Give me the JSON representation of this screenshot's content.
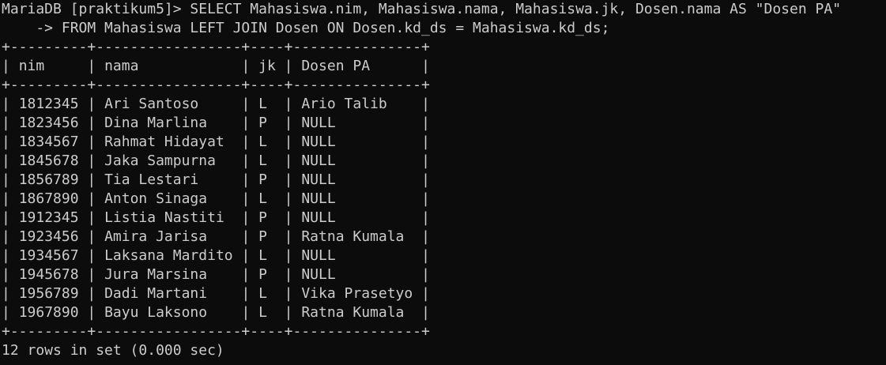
{
  "terminal": {
    "prompt": "MariaDB [praktikum5]> ",
    "command_line1": "SELECT Mahasiswa.nim, Mahasiswa.nama, Mahasiswa.jk, Dosen.nama AS \"Dosen PA\"",
    "continuation_prompt": "    -> ",
    "command_line2": "FROM Mahasiswa LEFT JOIN Dosen ON Dosen.kd_ds = Mahasiswa.kd_ds;",
    "result_footer": "12 rows in set (0.000 sec)",
    "colors": {
      "background": "#0c0c0c",
      "foreground": "#cccccc"
    }
  },
  "result_table": {
    "columns": [
      "nim",
      "nama",
      "jk",
      "Dosen PA"
    ],
    "rows": [
      [
        "1812345",
        "Ari Santoso",
        "L",
        "Ario Talib"
      ],
      [
        "1823456",
        "Dina Marlina",
        "P",
        "NULL"
      ],
      [
        "1834567",
        "Rahmat Hidayat",
        "L",
        "NULL"
      ],
      [
        "1845678",
        "Jaka Sampurna",
        "L",
        "NULL"
      ],
      [
        "1856789",
        "Tia Lestari",
        "P",
        "NULL"
      ],
      [
        "1867890",
        "Anton Sinaga",
        "L",
        "NULL"
      ],
      [
        "1912345",
        "Listia Nastiti",
        "P",
        "NULL"
      ],
      [
        "1923456",
        "Amira Jarisa",
        "P",
        "Ratna Kumala"
      ],
      [
        "1934567",
        "Laksana Mardito",
        "L",
        "NULL"
      ],
      [
        "1945678",
        "Jura Marsina",
        "P",
        "NULL"
      ],
      [
        "1956789",
        "Dadi Martani",
        "L",
        "Vika Prasetyo"
      ],
      [
        "1967890",
        "Bayu Laksono",
        "L",
        "Ratna Kumala"
      ]
    ]
  }
}
